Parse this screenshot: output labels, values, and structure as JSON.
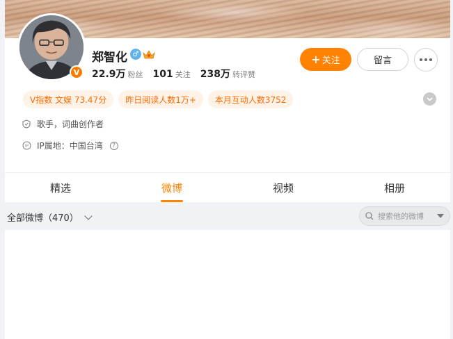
{
  "profile": {
    "name": "郑智化",
    "verified_badge": "V",
    "icons": {
      "gender": "male-icon",
      "crown": "crown-icon",
      "verified": "v-badge-icon"
    },
    "stats": [
      {
        "value": "22.9万",
        "label": "粉丝"
      },
      {
        "value": "101",
        "label": "关注"
      },
      {
        "value": "238万",
        "label": "转评赞"
      }
    ],
    "follow_label": "关注",
    "message_label": "留言",
    "tags": [
      "V指数 文娱 73.47分",
      "昨日阅读人数1万+",
      "本月互动人数3752"
    ],
    "bio": "歌手，词曲创作者",
    "ip_location": "IP属地：中国台湾"
  },
  "tabs": [
    "精选",
    "微博",
    "视频",
    "相册"
  ],
  "active_tab": "微博",
  "filter": {
    "label": "全部微博（470）",
    "search_placeholder": "搜索他的微博"
  },
  "colors": {
    "accent": "#ff8200",
    "tag_bg": "#fff3e8",
    "tag_text": "#ff6a00",
    "gender": "#62b3ea"
  }
}
